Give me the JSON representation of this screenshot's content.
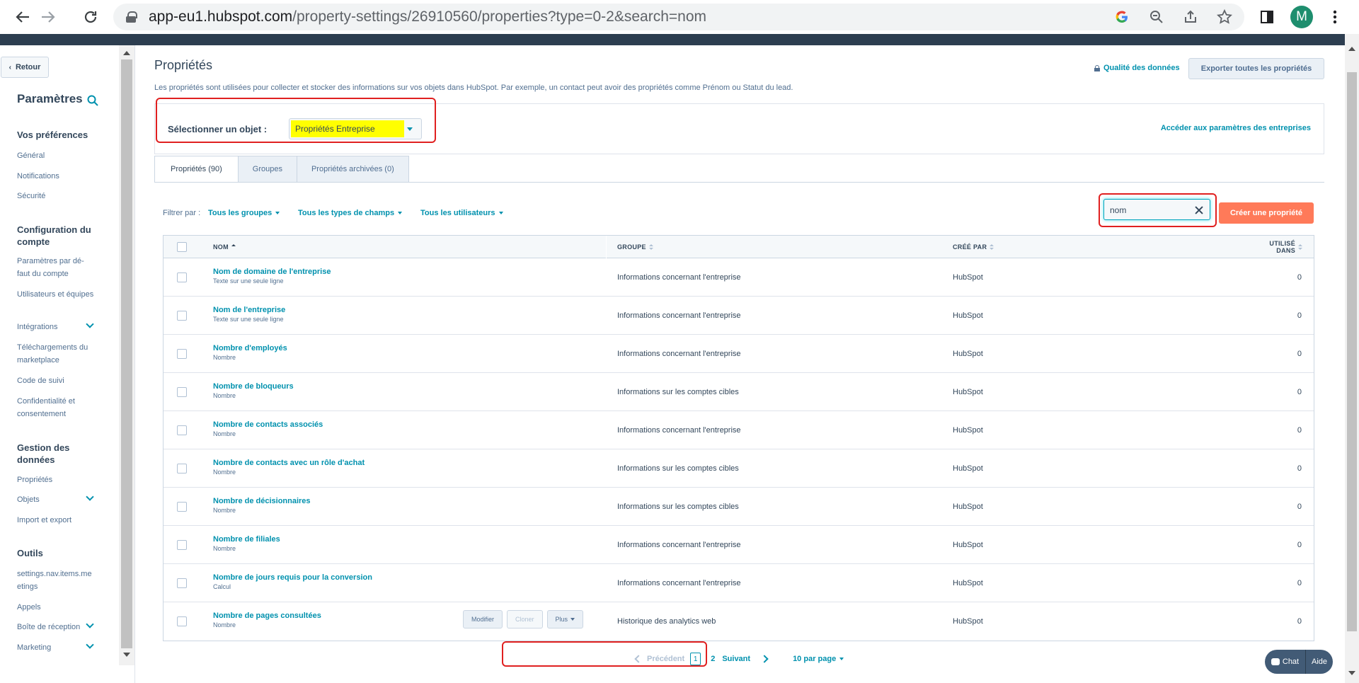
{
  "browser": {
    "url_host": "app-eu1.hubspot.com",
    "url_path": "/property-settings/26910560/properties?type=0-2&search=nom",
    "profile_initial": "M"
  },
  "sidebar": {
    "back_label": "Retour",
    "title": "Paramètres",
    "sections": [
      {
        "label": "Vos préférences",
        "items": [
          "Général",
          "Notifications",
          "Sécurité"
        ]
      },
      {
        "label": "Configuration du compte",
        "items": [
          "Paramètres par dé-faut du compte",
          "Utilisateurs et équipes",
          "Intégrations",
          "Téléchargements du marketplace",
          "Code de suivi",
          "Confidentialité et consentement"
        ]
      },
      {
        "label": "Gestion des données",
        "items": [
          "Propriétés",
          "Objets",
          "Import et export"
        ]
      },
      {
        "label": "Outils",
        "items": [
          "settings.nav.items.meetings",
          "Appels",
          "Boîte de réception",
          "Marketing"
        ]
      }
    ]
  },
  "main": {
    "title": "Propriétés",
    "description": "Les propriétés sont utilisées pour collecter et stocker des informations sur vos objets dans HubSpot. Par exemple, un contact peut avoir des propriétés comme Prénom ou Statut du lead.",
    "data_quality_link": "Qualité des données",
    "export_button": "Exporter toutes les propriétés",
    "object_select_label": "Sélectionner un objet :",
    "object_select_value": "Propriétés Entreprise",
    "object_settings_link": "Accéder aux paramètres des entreprises",
    "tabs": [
      "Propriétés (90)",
      "Groupes",
      "Propriétés archivées (0)"
    ],
    "filter_label": "Filtrer par :",
    "filters": [
      "Tous les groupes",
      "Tous les types de champs",
      "Tous les utilisateurs"
    ],
    "search_value": "nom",
    "create_button": "Créer une propriété",
    "columns": {
      "name": "NOM",
      "group": "GROUPE",
      "created_by": "CRÉÉ PAR",
      "used_in_1": "UTILISÉ",
      "used_in_2": "DANS"
    },
    "rows": [
      {
        "name": "Nom de domaine de l'entreprise",
        "type": "Texte sur une seule ligne",
        "group": "Informations concernant l'entreprise",
        "created_by": "HubSpot",
        "used": "0"
      },
      {
        "name": "Nom de l'entreprise",
        "type": "Texte sur une seule ligne",
        "group": "Informations concernant l'entreprise",
        "created_by": "HubSpot",
        "used": "0"
      },
      {
        "name": "Nombre d'employés",
        "type": "Nombre",
        "group": "Informations concernant l'entreprise",
        "created_by": "HubSpot",
        "used": "0"
      },
      {
        "name": "Nombre de bloqueurs",
        "type": "Nombre",
        "group": "Informations sur les comptes cibles",
        "created_by": "HubSpot",
        "used": "0"
      },
      {
        "name": "Nombre de contacts associés",
        "type": "Nombre",
        "group": "Informations concernant l'entreprise",
        "created_by": "HubSpot",
        "used": "0"
      },
      {
        "name": "Nombre de contacts avec un rôle d'achat",
        "type": "Nombre",
        "group": "Informations sur les comptes cibles",
        "created_by": "HubSpot",
        "used": "0"
      },
      {
        "name": "Nombre de décisionnaires",
        "type": "Nombre",
        "group": "Informations sur les comptes cibles",
        "created_by": "HubSpot",
        "used": "0"
      },
      {
        "name": "Nombre de filiales",
        "type": "Nombre",
        "group": "Informations concernant l'entreprise",
        "created_by": "HubSpot",
        "used": "0"
      },
      {
        "name": "Nombre de jours requis pour la conversion",
        "type": "Calcul",
        "group": "Informations concernant l'entreprise",
        "created_by": "HubSpot",
        "used": "0"
      },
      {
        "name": "Nombre de pages consultées",
        "type": "Nombre",
        "group": "Historique des analytics web",
        "created_by": "HubSpot",
        "used": "0"
      }
    ],
    "row_actions": [
      "Modifier",
      "Cloner",
      "Plus"
    ],
    "pagination": {
      "prev": "Précédent",
      "current": "1",
      "page2": "2",
      "next": "Suivant",
      "per_page": "10 par page"
    }
  },
  "chat_widget": {
    "chat": "Chat",
    "help": "Aide"
  },
  "colors": {
    "accent": "#0091ae",
    "cta": "#ff7a59",
    "highlight": "#ffff00",
    "annotation": "#e02020"
  }
}
